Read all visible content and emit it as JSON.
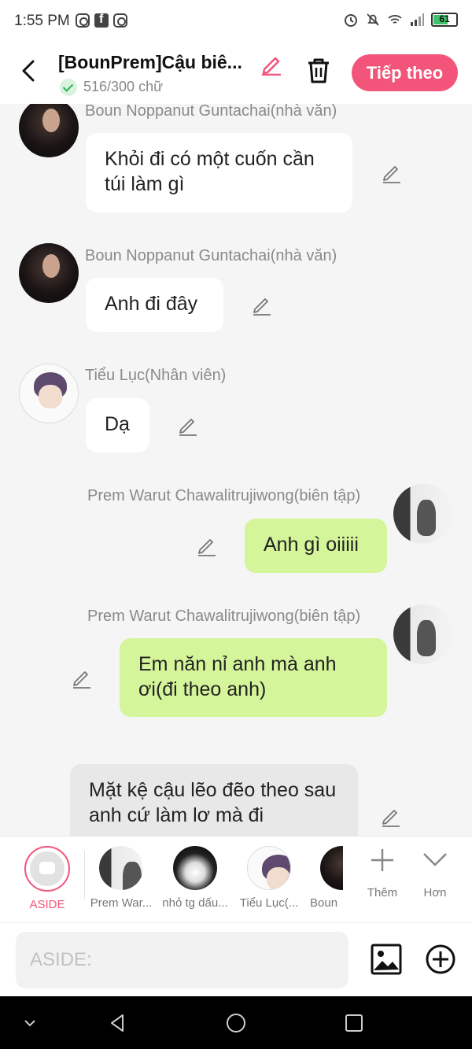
{
  "status_bar": {
    "time": "1:55 PM",
    "battery_level": "61",
    "icons": [
      "instagram-icon",
      "facebook-icon",
      "instagram-icon",
      "alarm-icon",
      "bell-off-icon",
      "wifi-icon",
      "signal-icon",
      "battery-icon"
    ]
  },
  "header": {
    "title": "[BounPrem]Cậu biê...",
    "word_count": "516/300 chữ",
    "next_label": "Tiếp theo",
    "accent_color": "#f3547a"
  },
  "messages": [
    {
      "sender": "Boun Noppanut Guntachai(nhà văn)",
      "text": "Khỏi đi có một cuốn cần túi làm gì",
      "side": "left"
    },
    {
      "sender": "Boun Noppanut Guntachai(nhà văn)",
      "text": "Anh đi đây",
      "side": "left"
    },
    {
      "sender": "Tiểu Lục(Nhân viên)",
      "text": "Dạ",
      "side": "left"
    },
    {
      "sender": "Prem Warut Chawalitrujiwong(biên tập)",
      "text": "Anh gì oiiiii",
      "side": "right"
    },
    {
      "sender": "Prem Warut Chawalitrujiwong(biên tập)",
      "text": "Em năn nỉ anh mà anh ơi(đi theo anh)",
      "side": "right"
    },
    {
      "sender": "",
      "text": "Mặt kệ cậu lẽo đẽo theo sau anh cứ làm lơ mà đi",
      "side": "aside"
    }
  ],
  "characters": {
    "aside_label": "ASIDE",
    "items": [
      {
        "label": "Prem War..."
      },
      {
        "label": "nhỏ tg dấu..."
      },
      {
        "label": "Tiểu Lục(..."
      },
      {
        "label": "Boun"
      }
    ],
    "more_label": "Thêm",
    "collapse_label": "Hơn"
  },
  "input": {
    "placeholder": "ASIDE:"
  },
  "colors": {
    "left_bubble": "#ffffff",
    "right_bubble": "#d4f59a",
    "aside_bubble": "#e8e8e8"
  }
}
